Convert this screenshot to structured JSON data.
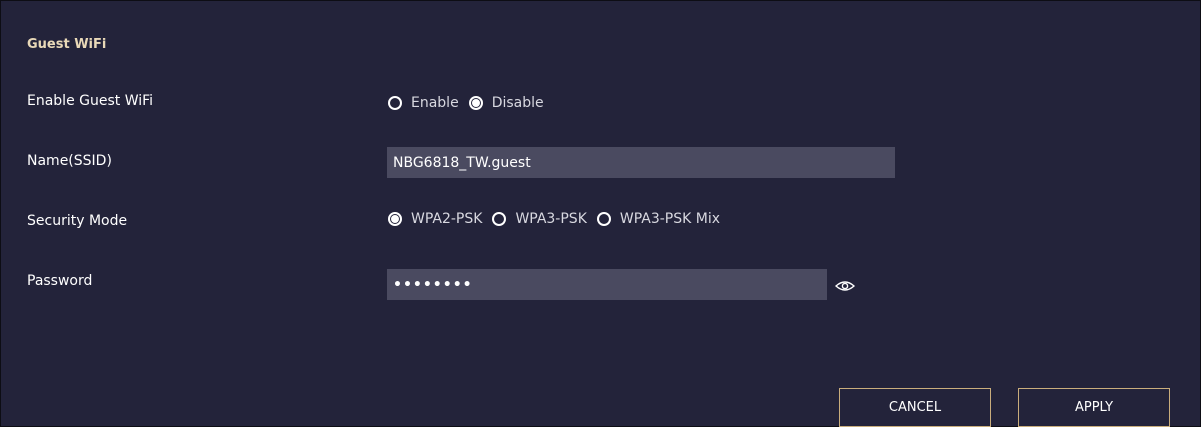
{
  "section": {
    "title": "Guest WiFi"
  },
  "enable_guest": {
    "label": "Enable Guest WiFi",
    "options": [
      {
        "label": "Enable",
        "selected": false
      },
      {
        "label": "Disable",
        "selected": true
      }
    ]
  },
  "ssid": {
    "label": "Name(SSID)",
    "value": "NBG6818_TW.guest"
  },
  "security_mode": {
    "label": "Security Mode",
    "options": [
      {
        "label": "WPA2-PSK",
        "selected": true
      },
      {
        "label": "WPA3-PSK",
        "selected": false
      },
      {
        "label": "WPA3-PSK Mix",
        "selected": false
      }
    ]
  },
  "password": {
    "label": "Password",
    "value": "••••••••",
    "icon": "eye-icon"
  },
  "buttons": {
    "cancel": "CANCEL",
    "apply": "APPLY"
  },
  "colors": {
    "background": "#23233a",
    "section_title": "#e9d9b8",
    "field_background": "#4a4a60",
    "button_border": "#c9ad7c"
  }
}
